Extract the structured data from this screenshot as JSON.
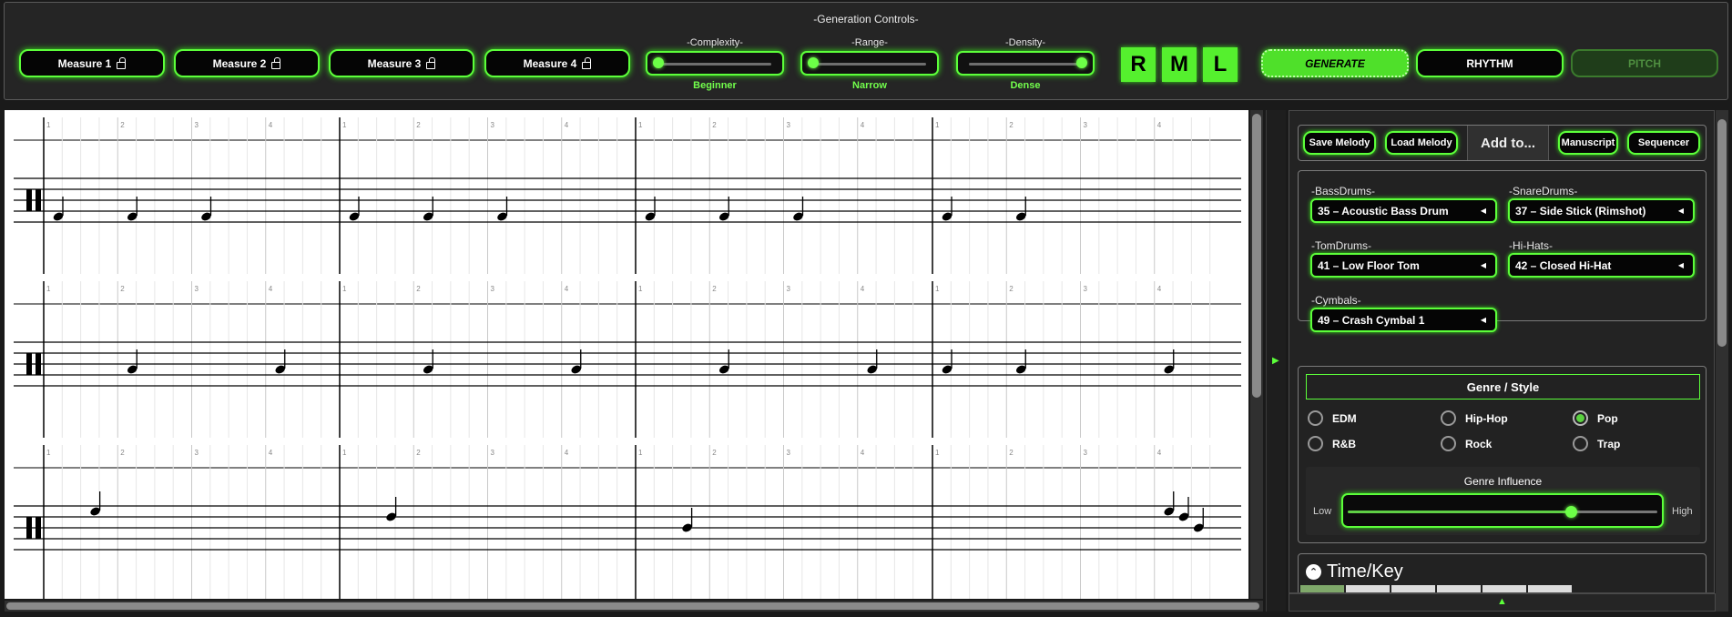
{
  "generation": {
    "title": "-Generation Controls-",
    "measures": [
      {
        "label": "Measure 1"
      },
      {
        "label": "Measure 2"
      },
      {
        "label": "Measure 3"
      },
      {
        "label": "Measure 4"
      }
    ],
    "sliders": [
      {
        "label": "-Complexity-",
        "value": "Beginner",
        "level": 0
      },
      {
        "label": "-Range-",
        "value": "Narrow",
        "level": 0
      },
      {
        "label": "-Density-",
        "value": "Dense",
        "level": 1
      }
    ],
    "rml": [
      "R",
      "M",
      "L"
    ],
    "actions": {
      "generate": "GENERATE",
      "rhythm": "RHYTHM",
      "pitch": "PITCH"
    }
  },
  "score": {
    "beat_numbers": [
      "1",
      "2",
      "3",
      "4"
    ],
    "systems": [
      {
        "measures": [
          [
            "1",
            "2",
            "3"
          ],
          [
            "1",
            "2",
            "3"
          ],
          [
            "1",
            "2",
            "3"
          ],
          [
            "1",
            "2"
          ]
        ]
      },
      {
        "measures": [
          [
            "2",
            "4"
          ],
          [
            "2",
            "4"
          ],
          [
            "2",
            "4"
          ],
          [
            "1",
            "2",
            "4"
          ]
        ]
      },
      {
        "measures": [
          [
            "1.5"
          ],
          [
            "1.5"
          ],
          [
            "1.5"
          ],
          [
            "4",
            "4.2",
            "4.4"
          ]
        ]
      }
    ]
  },
  "toolbar": {
    "save": "Save Melody",
    "load": "Load Melody",
    "addto": "Add to...",
    "manuscript": "Manuscript",
    "sequencer": "Sequencer"
  },
  "drums": {
    "bass_label": "-BassDrums-",
    "bass_value": "35 – Acoustic Bass Drum",
    "snare_label": "-SnareDrums-",
    "snare_value": "37 – Side Stick (Rimshot)",
    "tom_label": "-TomDrums-",
    "tom_value": "41 – Low Floor Tom",
    "hihat_label": "-Hi-Hats-",
    "hihat_value": "42 – Closed Hi-Hat",
    "cymbal_label": "-Cymbals-",
    "cymbal_value": "49 – Crash Cymbal 1"
  },
  "genre": {
    "title": "Genre / Style",
    "options": [
      {
        "label": "EDM",
        "selected": false
      },
      {
        "label": "Hip-Hop",
        "selected": false
      },
      {
        "label": "Pop",
        "selected": true
      },
      {
        "label": "R&B",
        "selected": false
      },
      {
        "label": "Rock",
        "selected": false
      },
      {
        "label": "Trap",
        "selected": false
      }
    ],
    "influence_title": "Genre Influence",
    "low": "Low",
    "high": "High",
    "influence_level": 0.72
  },
  "timekey": {
    "title": "Time/Key"
  },
  "colors": {
    "accent": "#5cff3a",
    "panel": "#232323",
    "bg": "#1a1a1a"
  }
}
